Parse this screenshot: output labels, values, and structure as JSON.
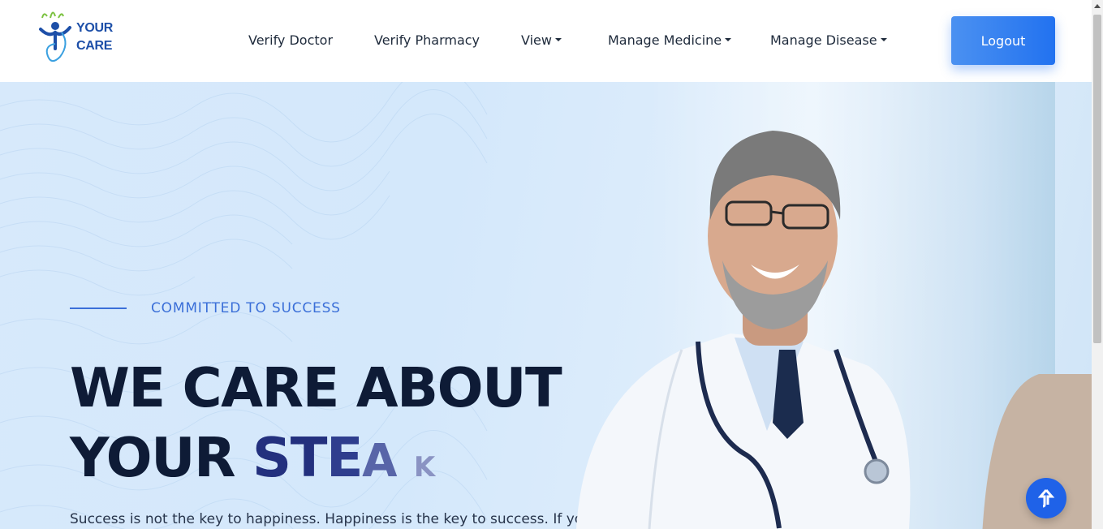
{
  "brand": {
    "logo_line1": "YOUR",
    "logo_line2": "CARE",
    "primary_color": "#1d4fa8",
    "leaf_color": "#7cc242",
    "accent_color": "#2272f0"
  },
  "nav": {
    "items": [
      {
        "label": "Verify Doctor",
        "dropdown": false
      },
      {
        "label": "Verify Pharmacy",
        "dropdown": false
      },
      {
        "label": "View",
        "dropdown": true
      },
      {
        "label": "Manage Medicine",
        "dropdown": true
      },
      {
        "label": "Manage Disease",
        "dropdown": true
      }
    ],
    "logout_label": "Logout"
  },
  "hero": {
    "tagline": "COMMITTED TO SUCCESS",
    "headline_line1": "WE CARE ABOUT",
    "headline_line2_prefix": "YOUR",
    "typed_text": {
      "c1": "S",
      "c2": "T",
      "c3": "E",
      "c4": "A",
      "c5": "K"
    },
    "description": "Success is not the key to happiness. Happiness is the key to success. If you"
  },
  "scroll_top": {
    "icon": "arrow-up-icon"
  }
}
